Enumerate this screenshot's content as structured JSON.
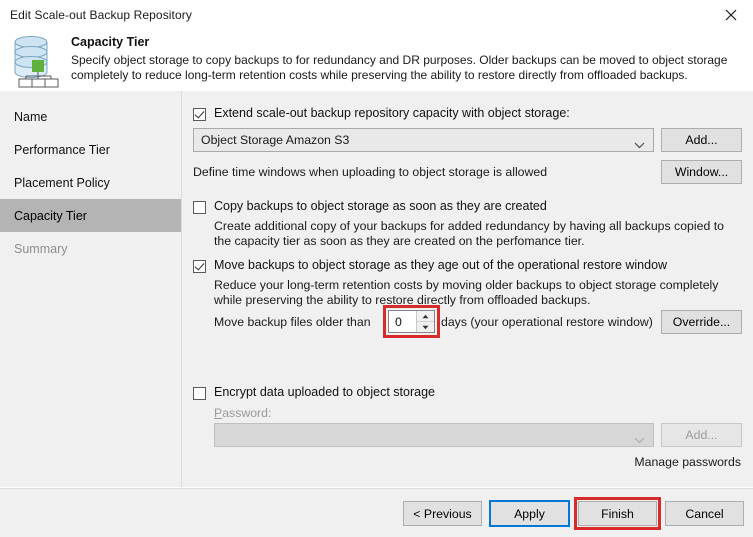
{
  "window": {
    "title": "Edit Scale-out Backup Repository",
    "close_icon": "close-icon"
  },
  "header": {
    "icon": "capacity-tier-database-icon",
    "title": "Capacity Tier",
    "description": "Specify object storage to copy backups to for redundancy and DR purposes. Older backups can be moved to object storage completely to reduce long-term retention costs while preserving the ability to restore directly from offloaded backups."
  },
  "sidebar": {
    "items": [
      {
        "label": "Name",
        "state": "normal"
      },
      {
        "label": "Performance Tier",
        "state": "normal"
      },
      {
        "label": "Placement Policy",
        "state": "normal"
      },
      {
        "label": "Capacity Tier",
        "state": "selected"
      },
      {
        "label": "Summary",
        "state": "disabled"
      }
    ]
  },
  "main": {
    "extend": {
      "checked": true,
      "label": "Extend scale-out backup repository capacity with object storage:"
    },
    "repository_combo": {
      "value": "Object Storage Amazon S3",
      "arrow_icon": "chevron-down-icon"
    },
    "add_repository_button": "Add...",
    "time_window_label": "Define time windows when uploading to object storage is allowed",
    "window_button": "Window...",
    "copy_option": {
      "checked": false,
      "label": "Copy backups to object storage as soon as they are created",
      "description": "Create additional copy of your backups for added redundancy by having all backups copied to the capacity tier as soon as they are created on the perfomance tier."
    },
    "move_option": {
      "checked": true,
      "label": "Move backups to object storage as they age out of the operational restore window",
      "description": "Reduce your long-term retention costs by moving older backups to object storage completely while preserving the ability to restore directly from offloaded backups."
    },
    "move_age": {
      "prefix": "Move backup files older than",
      "value": "0",
      "suffix": "days (your operational restore window)",
      "up_icon": "spinner-up-icon",
      "down_icon": "spinner-down-icon",
      "highlighted": true
    },
    "override_button": "Override...",
    "encrypt_option": {
      "checked": false,
      "label": "Encrypt data uploaded to object storage"
    },
    "password_label": "Password:",
    "password_combo": {
      "value": "",
      "arrow_icon": "chevron-down-icon",
      "disabled": true
    },
    "password_add_button": "Add...",
    "manage_passwords_link": "Manage passwords"
  },
  "footer": {
    "previous_button": "< Previous",
    "apply_button": "Apply",
    "finish_button": "Finish",
    "cancel_button": "Cancel"
  },
  "colors": {
    "accent_focus": "#0078d7",
    "annotation_red": "#d82b2b",
    "sidebar_selected": "#b4b4b4",
    "panel_bg": "#f0f0f0"
  }
}
